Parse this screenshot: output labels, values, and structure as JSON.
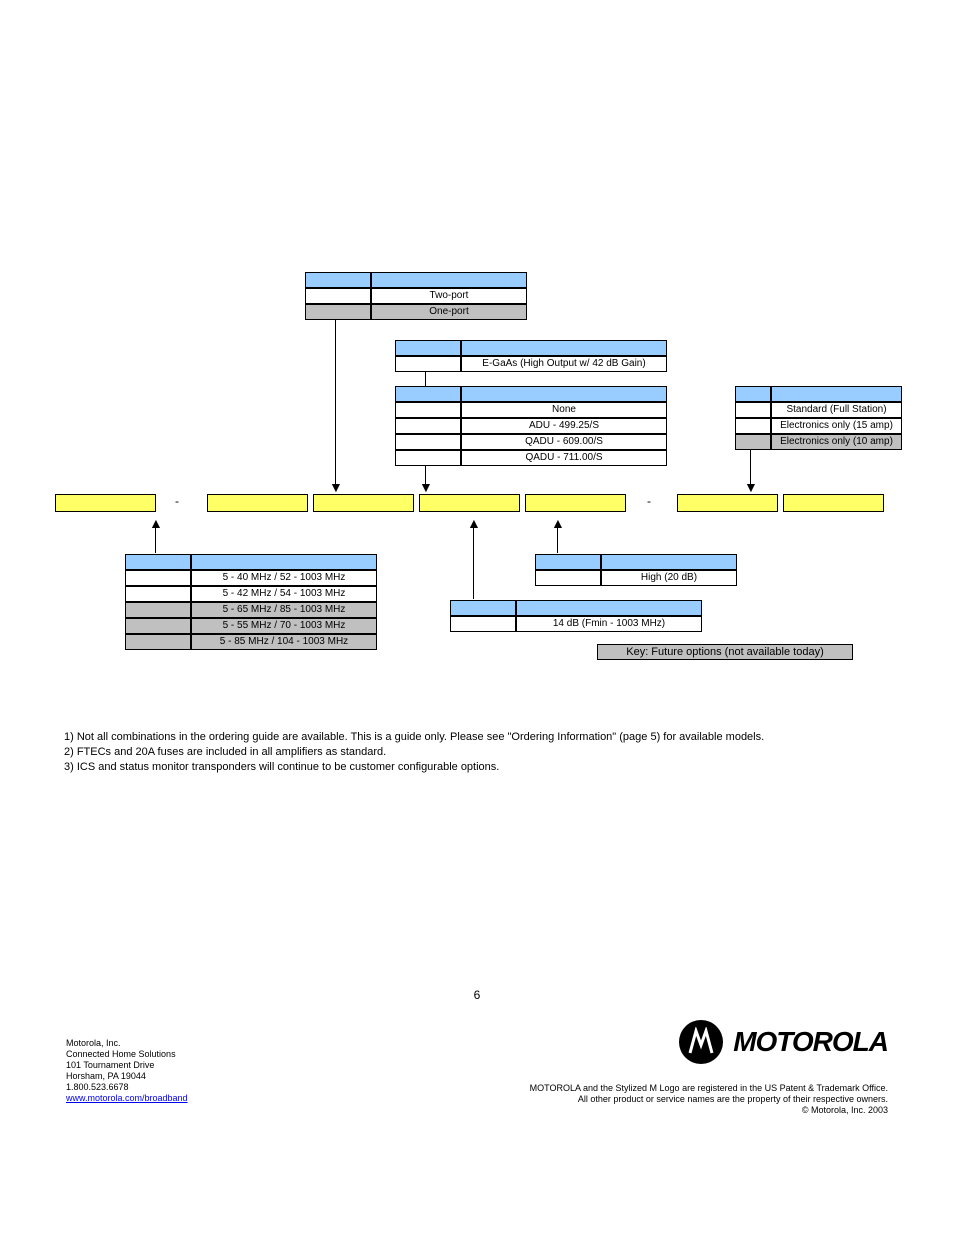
{
  "diagram": {
    "ports": {
      "two": "Two-port",
      "one": "One-port"
    },
    "gain": "E-GaAs (High Output w/ 42 dB Gain)",
    "adu": {
      "none": "None",
      "a1": "ADU - 499.25/S",
      "a2": "QADU - 609.00/S",
      "a3": "QADU - 711.00/S"
    },
    "station": {
      "s1": "Standard (Full Station)",
      "s2": "Electronics only (15 amp)",
      "s3": "Electronics only (10 amp)"
    },
    "bands": {
      "b1": "5 - 40 MHz / 52 - 1003 MHz",
      "b2": "5 - 42 MHz / 54 - 1003 MHz",
      "b3": "5 - 65 MHz / 85 - 1003 MHz",
      "b4": "5 - 55 MHz / 70 - 1003 MHz",
      "b5": "5 - 85 MHz / 104 - 1003 MHz"
    },
    "rgain": "High (20 dB)",
    "slope": "14 dB (Fmin - 1003 MHz)",
    "key": "Key: Future options (not available today)"
  },
  "notes": {
    "n1": "1) Not all combinations in the ordering guide are available.  This is a guide only.  Please see \"Ordering Information\" (page 5) for available models.",
    "n2": "2) FTECs and 20A fuses are included in all amplifiers as standard.",
    "n3": "3) ICS and status monitor transponders will continue to be customer configurable options."
  },
  "page": "6",
  "footer": {
    "company": "Motorola, Inc.",
    "div": "Connected Home Solutions",
    "addr1": "101 Tournament Drive",
    "addr2": "Horsham, PA 19044",
    "phone": "1.800.523.6678",
    "url": "www.motorola.com/broadband",
    "legal1": "MOTOROLA and the Stylized M Logo are registered in the US Patent & Trademark Office.",
    "legal2": "All other product or service names are the property of their respective owners.",
    "copy": "© Motorola, Inc. 2003",
    "logotext": "MOTOROLA"
  }
}
